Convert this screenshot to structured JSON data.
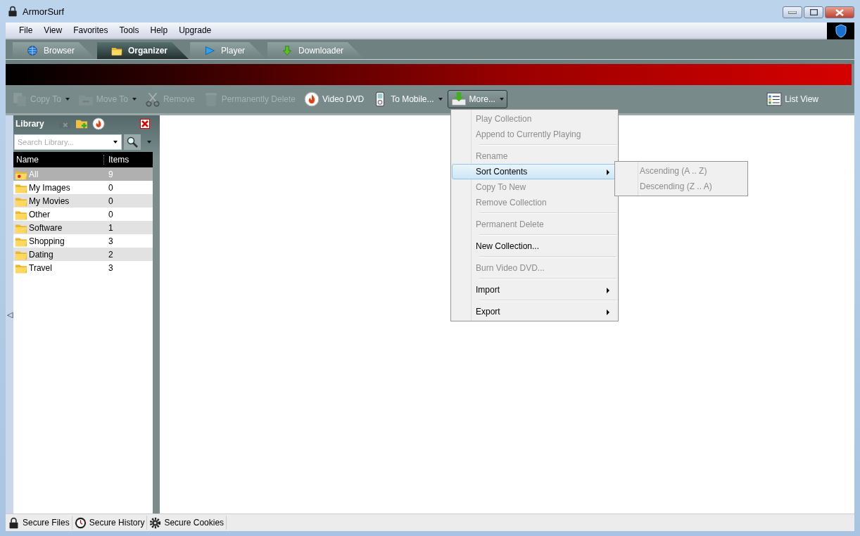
{
  "window": {
    "title": "ArmorSurf"
  },
  "menu_bar": [
    "File",
    "View",
    "Favorites",
    "Tools",
    "Help",
    "Upgrade"
  ],
  "tabs": [
    {
      "label": "Browser",
      "kind": "globe",
      "selected": false
    },
    {
      "label": "Organizer",
      "kind": "folder",
      "selected": true
    },
    {
      "label": "Player",
      "kind": "play",
      "selected": false
    },
    {
      "label": "Downloader",
      "kind": "download",
      "selected": false
    }
  ],
  "toolbar": [
    {
      "label": "Copy To",
      "kind": "copy",
      "disabled": true,
      "dropdown": true,
      "pressed": false
    },
    {
      "label": "Move To",
      "kind": "move",
      "disabled": true,
      "dropdown": true,
      "pressed": false
    },
    {
      "label": "Remove",
      "kind": "scissors",
      "disabled": true,
      "dropdown": false,
      "pressed": false
    },
    {
      "label": "Permanently Delete",
      "kind": "trash",
      "disabled": true,
      "dropdown": false,
      "pressed": false
    },
    {
      "label": "Video DVD",
      "kind": "dvd",
      "disabled": false,
      "dropdown": false,
      "pressed": false
    },
    {
      "label": "To Mobile...",
      "kind": "mobile",
      "disabled": false,
      "dropdown": true,
      "pressed": false
    },
    {
      "label": "More...",
      "kind": "install",
      "disabled": false,
      "dropdown": true,
      "pressed": true
    }
  ],
  "view_button": {
    "label": "List View"
  },
  "sidebar_toggle": "◁",
  "library": {
    "title": "Library",
    "search": {
      "placeholder": "Search Library..."
    },
    "columns": [
      "Name",
      "Items"
    ],
    "rows": [
      {
        "name": "All",
        "items": "9",
        "kind": "special",
        "selected": true
      },
      {
        "name": "My Images",
        "items": "0",
        "kind": "folder",
        "selected": false
      },
      {
        "name": "My Movies",
        "items": "0",
        "kind": "folder",
        "selected": false
      },
      {
        "name": "Other",
        "items": "0",
        "kind": "folder",
        "selected": false
      },
      {
        "name": "Software",
        "items": "1",
        "kind": "folder",
        "selected": false
      },
      {
        "name": "Shopping",
        "items": "3",
        "kind": "folder",
        "selected": false
      },
      {
        "name": "Dating",
        "items": "2",
        "kind": "folder",
        "selected": false
      },
      {
        "name": "Travel",
        "items": "3",
        "kind": "folder",
        "selected": false
      }
    ]
  },
  "context_menu": {
    "groups": [
      [
        {
          "label": "Play Collection",
          "disabled": true,
          "selected": false,
          "submenu": false
        },
        {
          "label": "Append to Currently Playing",
          "disabled": true,
          "selected": false,
          "submenu": false
        }
      ],
      [
        {
          "label": "Rename",
          "disabled": true,
          "selected": false,
          "submenu": false
        },
        {
          "label": "Sort Contents",
          "disabled": false,
          "selected": true,
          "submenu": true
        },
        {
          "label": "Copy To New",
          "disabled": true,
          "selected": false,
          "submenu": false
        },
        {
          "label": "Remove Collection",
          "disabled": true,
          "selected": false,
          "submenu": false
        }
      ],
      [
        {
          "label": "Permanent Delete",
          "disabled": true,
          "selected": false,
          "submenu": false
        }
      ],
      [
        {
          "label": "New Collection...",
          "disabled": false,
          "selected": false,
          "submenu": false
        }
      ],
      [
        {
          "label": "Burn Video DVD...",
          "disabled": true,
          "selected": false,
          "submenu": false
        }
      ],
      [
        {
          "label": "Import",
          "disabled": false,
          "selected": false,
          "submenu": true
        }
      ],
      [
        {
          "label": "Export",
          "disabled": false,
          "selected": false,
          "submenu": true
        }
      ]
    ],
    "submenu": [
      {
        "label": "Ascending (A .. Z)",
        "disabled": true
      },
      {
        "label": "Descending (Z .. A)",
        "disabled": true
      }
    ]
  },
  "status_bar": [
    {
      "label": "Secure Files",
      "kind": "lock"
    },
    {
      "label": "Secure History",
      "kind": "clock"
    },
    {
      "label": "Secure Cookies",
      "kind": "gear"
    }
  ]
}
